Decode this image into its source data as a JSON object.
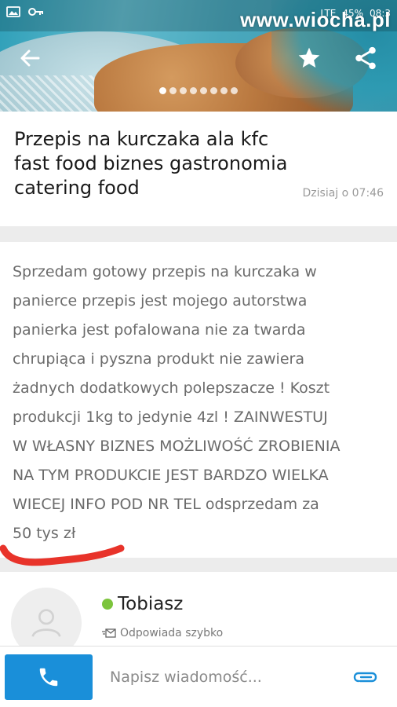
{
  "watermark": "www.wiocha.pl",
  "status_bar": {
    "network": "LTE",
    "battery": "45%",
    "time": "08:3"
  },
  "gallery": {
    "photo_count": 8,
    "active_index": 0
  },
  "listing": {
    "title": "Przepis na kurczaka ala kfc fast food biznes gastronomia catering food",
    "date": "Dzisiaj o 07:46",
    "description": "Sprzedam gotowy przepis na kurczaka w\npanierce przepis jest mojego autorstwa\npanierka jest pofalowana nie za twarda\nchrupiąca i pyszna produkt nie zawiera\nżadnych dodatkowych polepszacze ! Koszt\nprodukcji 1kg to jedynie 4zl !  ZAINWESTUJ\nW WŁASNY BIZNES MOŻLIWOŚĆ ZROBIENIA\nNA TYM PRODUKCIE JEST BARDZO WIELKA\nWIECEJ INFO POD NR TEL  odsprzedam za\n50 tys zł"
  },
  "seller": {
    "name": "Tobiasz",
    "status": "Odpowiada szybko",
    "online_color": "#7cc43c"
  },
  "bottom_bar": {
    "message_placeholder": "Napisz wiadomość...",
    "call_color": "#1a8fd9",
    "attach_color": "#1a8fd9"
  },
  "icons": [
    "back-arrow-icon",
    "star-icon",
    "share-icon",
    "user-icon",
    "message-icon",
    "phone-icon",
    "paperclip-icon",
    "key-icon"
  ],
  "annotation": {
    "color": "#e8332a"
  }
}
